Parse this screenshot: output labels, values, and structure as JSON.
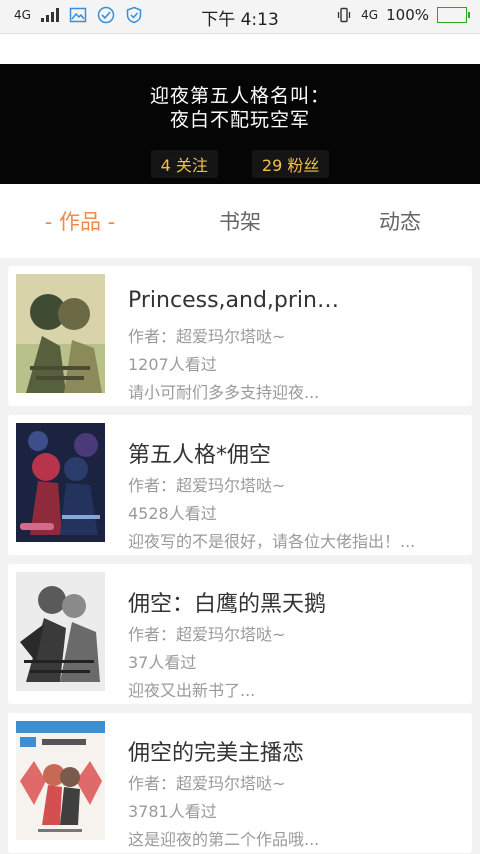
{
  "status_bar": {
    "network_left": "4G",
    "time": "下午 4:13",
    "network_right": "4G",
    "battery": "100%",
    "battery_level": 1.0
  },
  "profile": {
    "name_line1": "迎夜第五人格名叫：",
    "name_line2": "夜白不配玩空军",
    "following": "4 关注",
    "followers": "29 粉丝"
  },
  "tabs": [
    {
      "label": "- 作品 -",
      "active": true
    },
    {
      "label": "书架",
      "active": false
    },
    {
      "label": "动态",
      "active": false
    }
  ],
  "books": [
    {
      "title": "Princess,and,prin…",
      "author": "作者：超爱玛尔塔哒~",
      "views": "1207人看过",
      "desc": "请小可耐们多多支持迎夜..."
    },
    {
      "title": "第五人格*佣空",
      "author": "作者：超爱玛尔塔哒~",
      "views": "4528人看过",
      "desc": "迎夜写的不是很好，请各位大佬指出！..."
    },
    {
      "title": "佣空：白鹰的黑天鹅",
      "author": "作者：超爱玛尔塔哒~",
      "views": "37人看过",
      "desc": "迎夜又出新书了..."
    },
    {
      "title": "佣空的完美主播恋",
      "author": "作者：超爱玛尔塔哒~",
      "views": "3781人看过",
      "desc": "这是迎夜的第二个作品哦..."
    }
  ],
  "colors": {
    "accent": "#f08a4b",
    "stat_text": "#f2c04a",
    "banner_bg": "#050505"
  }
}
